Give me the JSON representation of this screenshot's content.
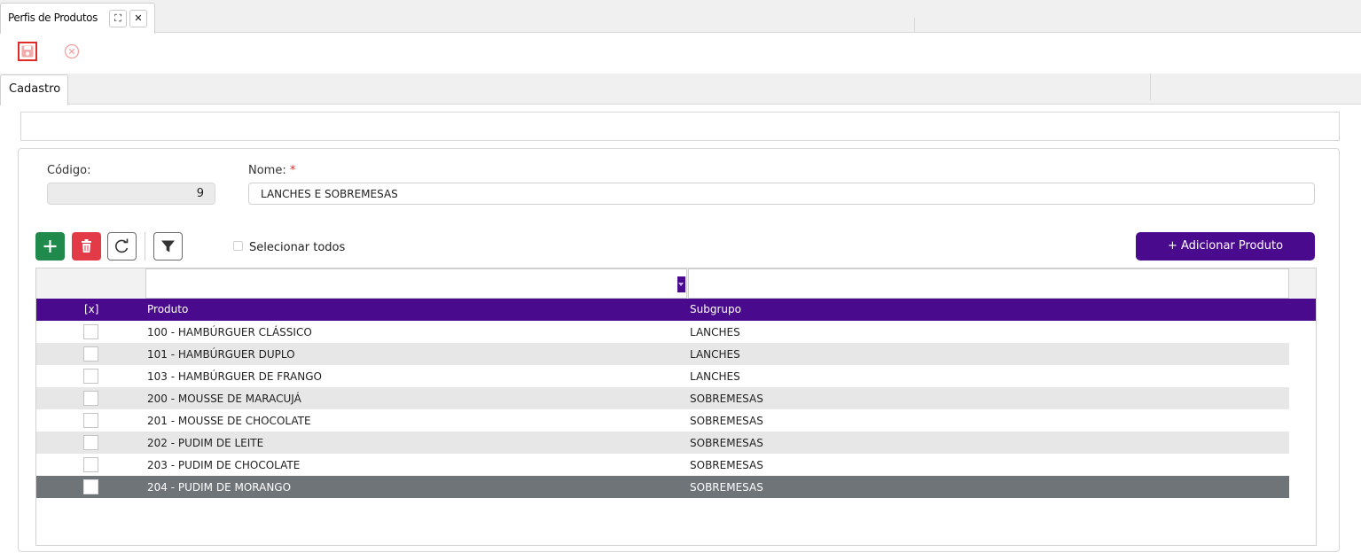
{
  "window": {
    "tab_title": "Perfis de Produtos",
    "maximize_icon": "⛶",
    "close_icon": "✕"
  },
  "section": {
    "tab": "Cadastro"
  },
  "form": {
    "codigo_label": "Código:",
    "codigo_value": "9",
    "nome_label": "Nome:",
    "nome_required": "*",
    "nome_value": "LANCHES E SOBREMESAS"
  },
  "toolbar": {
    "select_all": "Selecionar todos",
    "add_product": "+ Adicionar Produto"
  },
  "grid": {
    "headers": {
      "check": "[x]",
      "produto": "Produto",
      "subgrupo": "Subgrupo"
    },
    "rows": [
      {
        "produto": "100 - HAMBÚRGUER CLÁSSICO",
        "subgrupo": "LANCHES"
      },
      {
        "produto": "101 - HAMBÚRGUER DUPLO",
        "subgrupo": "LANCHES"
      },
      {
        "produto": "103 - HAMBÚRGUER DE FRANGO",
        "subgrupo": "LANCHES"
      },
      {
        "produto": "200 - MOUSSE DE MARACUJÁ",
        "subgrupo": "SOBREMESAS"
      },
      {
        "produto": "201 - MOUSSE DE CHOCOLATE",
        "subgrupo": "SOBREMESAS"
      },
      {
        "produto": "202 - PUDIM DE LEITE",
        "subgrupo": "SOBREMESAS"
      },
      {
        "produto": "203 - PUDIM DE CHOCOLATE",
        "subgrupo": "SOBREMESAS"
      },
      {
        "produto": "204 - PUDIM DE MORANGO",
        "subgrupo": "SOBREMESAS"
      }
    ]
  },
  "colors": {
    "primary": "#4a0a8e",
    "add": "#1f8a4c",
    "delete": "#e33a48",
    "selected_row": "#6f7479"
  }
}
